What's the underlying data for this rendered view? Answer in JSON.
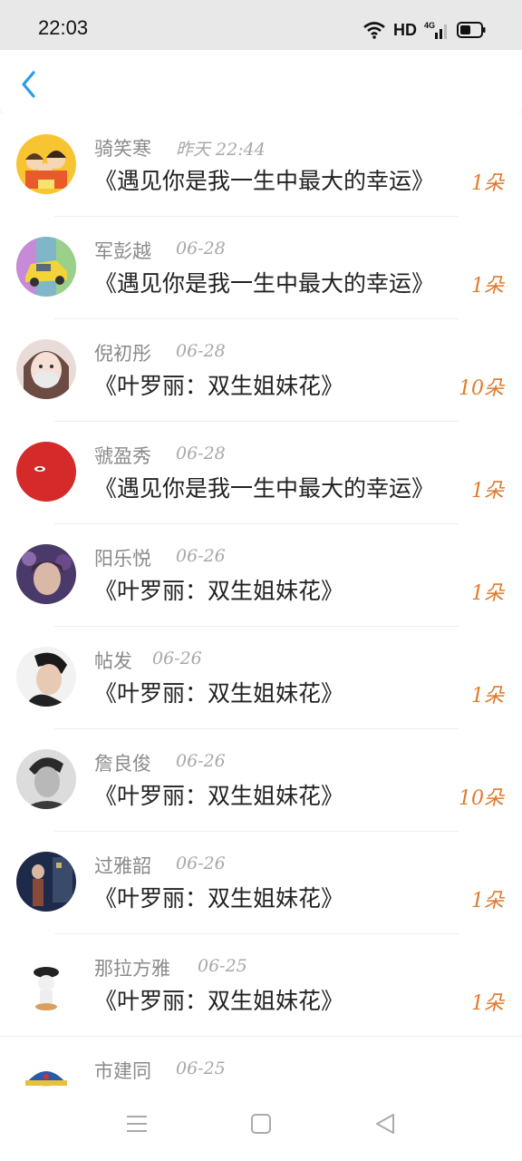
{
  "status_bar": {
    "time": "22:03",
    "network": "HD",
    "signal": "4G",
    "icons": [
      "wifi-icon",
      "signal-icon",
      "battery-icon"
    ]
  },
  "header": {
    "back_icon": "chevron-left-icon",
    "accent": "#2a9de6"
  },
  "rows": [
    {
      "name": "骑笑寒",
      "time": "昨天 22:44",
      "message": "《遇见你是我一生中最大的幸运》",
      "count": "1朵",
      "avatar": "cartoon-family-avatar"
    },
    {
      "name": "军彭越",
      "time": "06-28",
      "message": "《遇见你是我一生中最大的幸运》",
      "count": "1朵",
      "avatar": "toy-car-avatar"
    },
    {
      "name": "倪初彤",
      "time": "06-28",
      "message": "《叶罗丽：双生姐妹花》",
      "count": "10朵",
      "avatar": "girl-mask-avatar"
    },
    {
      "name": "虢盈秀",
      "time": "06-28",
      "message": "《遇见你是我一生中最大的幸运》",
      "count": "1朵",
      "avatar": "red-circle-avatar"
    },
    {
      "name": "阳乐悦",
      "time": "06-26",
      "message": "《叶罗丽：双生姐妹花》",
      "count": "1朵",
      "avatar": "purple-portrait-avatar"
    },
    {
      "name": "帖发",
      "time": "06-26",
      "message": "《叶罗丽：双生姐妹花》",
      "count": "1朵",
      "avatar": "man-portrait-avatar"
    },
    {
      "name": "詹良俊",
      "time": "06-26",
      "message": "《叶罗丽：双生姐妹花》",
      "count": "10朵",
      "avatar": "bw-portrait-avatar"
    },
    {
      "name": "过雅韶",
      "time": "06-26",
      "message": "《叶罗丽：双生姐妹花》",
      "count": "1朵",
      "avatar": "night-street-avatar"
    },
    {
      "name": "那拉方雅",
      "time": "06-25",
      "message": "《叶罗丽：双生姐妹花》",
      "count": "1朵",
      "avatar": "police-figure-avatar"
    },
    {
      "name": "市建同",
      "time": "06-25",
      "message": "",
      "count": "",
      "avatar": "cartoon-hat-avatar"
    }
  ],
  "nav_bar": {
    "icons": [
      "menu-icon",
      "home-square-icon",
      "back-triangle-icon"
    ]
  },
  "colors": {
    "count": "#e07a2e",
    "name": "#8a8a8a",
    "time": "#a8a8a8",
    "status_bg": "#e8e8e8"
  }
}
